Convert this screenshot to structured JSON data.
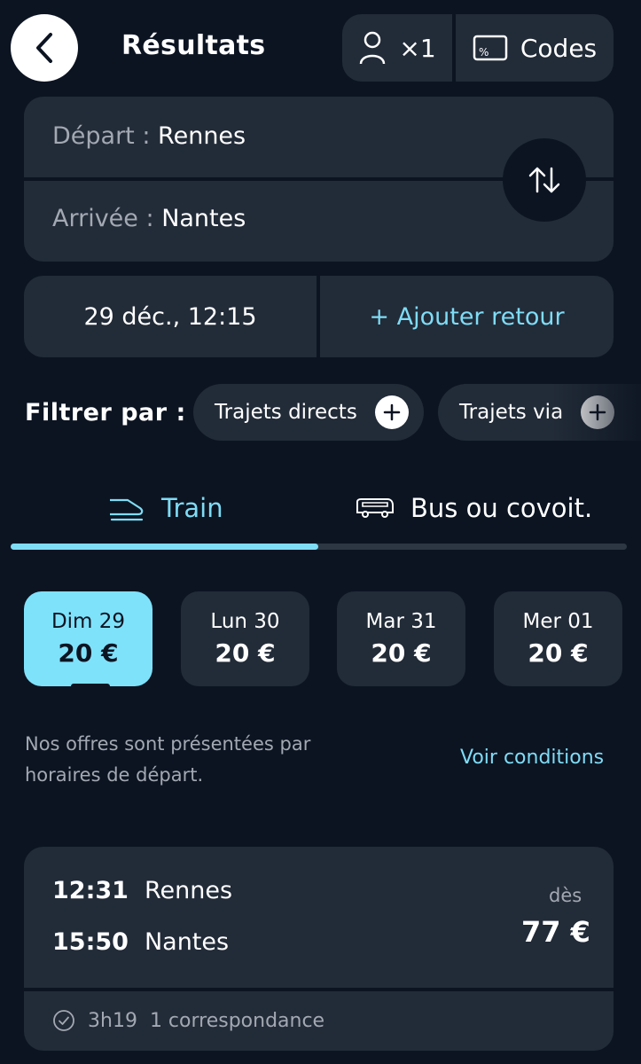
{
  "header": {
    "title": "Résultats",
    "passengers": "×1",
    "codes": "Codes"
  },
  "route": {
    "departure_label": "Départ :",
    "departure_value": "Rennes",
    "arrival_label": "Arrivée :",
    "arrival_value": "Nantes"
  },
  "dates": {
    "outbound": "29 déc., 12:15",
    "add_return": "+ Ajouter retour"
  },
  "filters": {
    "label": "Filtrer par :",
    "chips": [
      "Trajets directs",
      "Trajets via"
    ]
  },
  "modes": {
    "train": "Train",
    "bus": "Bus ou covoit.",
    "active": "train"
  },
  "days": [
    {
      "day": "Dim 29",
      "price": "20 €",
      "active": true
    },
    {
      "day": "Lun 30",
      "price": "20 €",
      "active": false
    },
    {
      "day": "Mar 31",
      "price": "20 €",
      "active": false
    },
    {
      "day": "Mer 01",
      "price": "20 €",
      "active": false
    }
  ],
  "info": {
    "text": "Nos offres sont présentées par horaires de départ.",
    "conditions_link": "Voir conditions"
  },
  "result": {
    "dep_time": "12:31",
    "dep_city": "Rennes",
    "arr_time": "15:50",
    "arr_city": "Nantes",
    "from_label": "dès",
    "price": "77 €",
    "duration": "3h19",
    "connections": "1 correspondance"
  },
  "colors": {
    "background": "#0c1422",
    "card": "#222b38",
    "accent": "#7fdcf5",
    "active_day": "#7fe2fb"
  },
  "icons": {
    "back": "chevron-left-icon",
    "passenger": "person-icon",
    "codes": "discount-card-icon",
    "swap": "swap-vertical-icon",
    "plus": "plus-icon",
    "train": "train-icon",
    "bus": "bus-icon",
    "duration": "clock-check-icon"
  }
}
